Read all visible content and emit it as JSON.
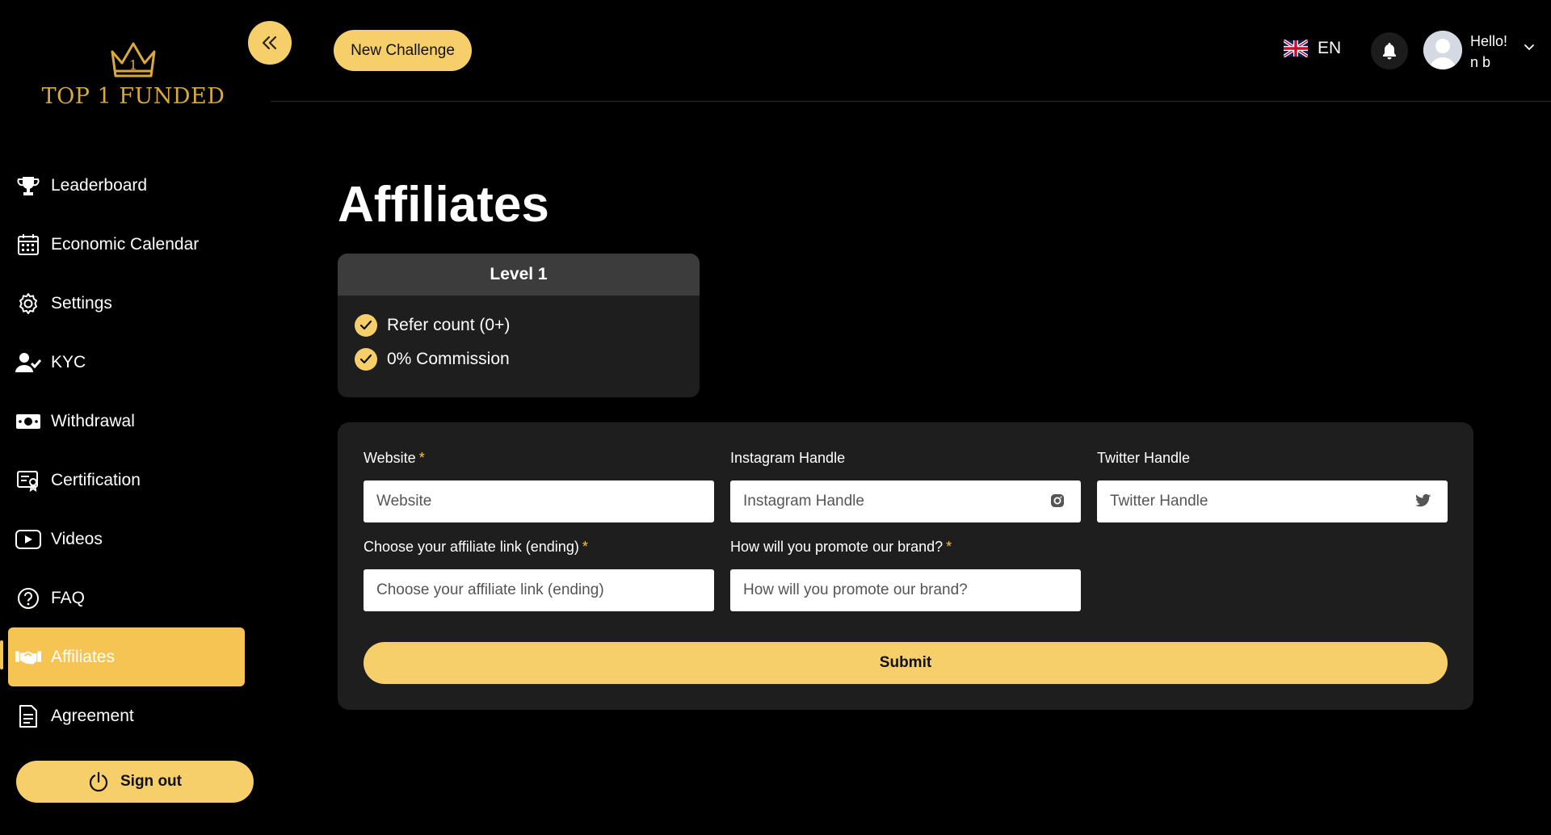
{
  "brand": {
    "logo_text": "TOP 1 FUNDED",
    "accent_color": "#f6c453"
  },
  "header": {
    "new_challenge_label": "New Challenge",
    "language": {
      "flag_icon": "uk-flag-icon",
      "code": "EN"
    },
    "user": {
      "greeting": "Hello!",
      "name": "n b"
    }
  },
  "sidebar": {
    "items": [
      {
        "label": "Leaderboard",
        "icon": "trophy-icon"
      },
      {
        "label": "Economic Calendar",
        "icon": "calendar-icon"
      },
      {
        "label": "Settings",
        "icon": "gear-icon"
      },
      {
        "label": "KYC",
        "icon": "user-check-icon"
      },
      {
        "label": "Withdrawal",
        "icon": "cash-icon"
      },
      {
        "label": "Certification",
        "icon": "certificate-icon"
      },
      {
        "label": "Videos",
        "icon": "video-play-icon"
      },
      {
        "label": "FAQ",
        "icon": "question-icon"
      },
      {
        "label": "Affiliates",
        "icon": "handshake-icon",
        "active": true
      },
      {
        "label": "Agreement",
        "icon": "document-icon"
      }
    ],
    "signout_label": "Sign out"
  },
  "main": {
    "title": "Affiliates",
    "level": {
      "title": "Level 1",
      "features": [
        "Refer count (0+)",
        "0% Commission"
      ]
    },
    "form": {
      "website": {
        "label": "Website",
        "required_mark": "*",
        "placeholder": "Website",
        "value": ""
      },
      "instagram": {
        "label": "Instagram Handle",
        "placeholder": "Instagram Handle",
        "value": ""
      },
      "twitter": {
        "label": "Twitter Handle",
        "placeholder": "Twitter Handle",
        "value": ""
      },
      "affiliate_link": {
        "label": "Choose your affiliate link (ending)",
        "required_mark": "*",
        "placeholder": "Choose your affiliate link (ending)",
        "value": ""
      },
      "promote": {
        "label": "How will you promote our brand?",
        "required_mark": "*",
        "placeholder": "How will you promote our brand?",
        "value": ""
      },
      "submit_label": "Submit"
    }
  }
}
